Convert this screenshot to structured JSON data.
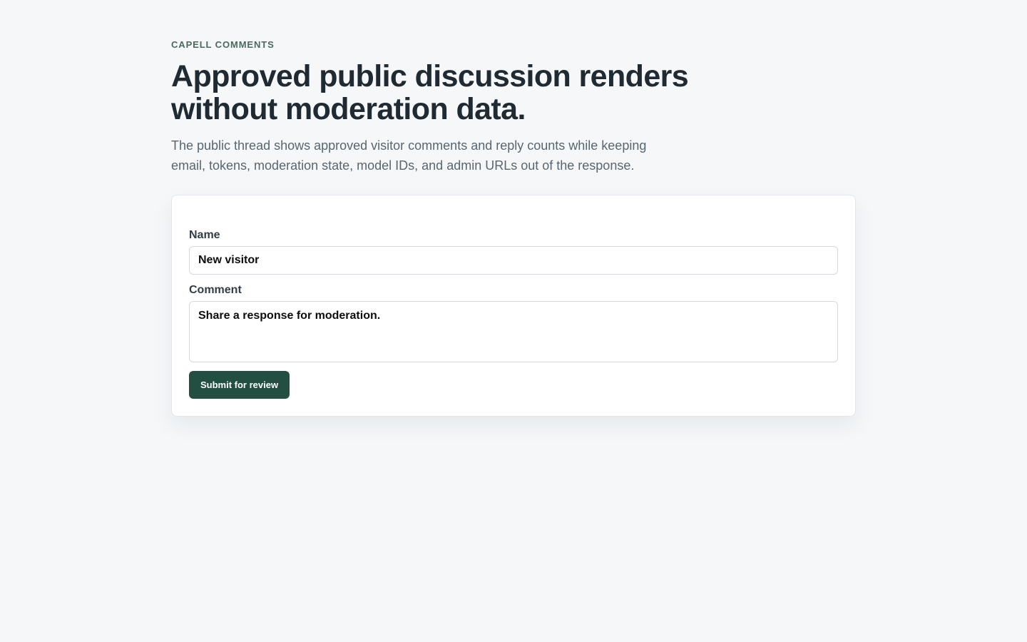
{
  "header": {
    "eyebrow": "CAPELL COMMENTS",
    "title": "Approved public discussion renders without moderation data.",
    "subtitle": "The public thread shows approved visitor comments and reply counts while keeping email, tokens, moderation state, model IDs, and admin URLs out of the response."
  },
  "form": {
    "name_label": "Name",
    "name_value": "New visitor",
    "comment_label": "Comment",
    "comment_value": "Share a response for moderation.",
    "submit_label": "Submit for review"
  },
  "colors": {
    "background": "#f5f7f9",
    "accent": "#234f43",
    "eyebrow": "#4a6a5c"
  }
}
